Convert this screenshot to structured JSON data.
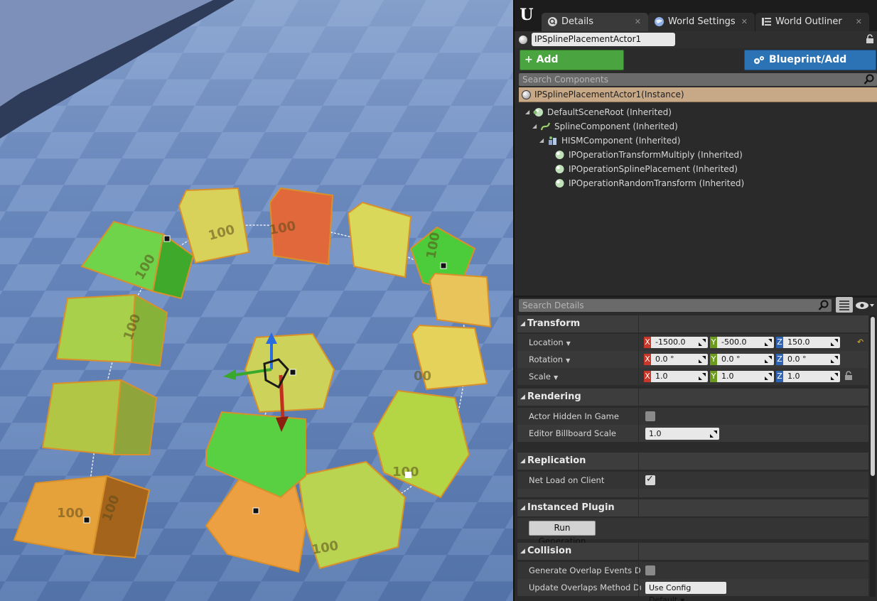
{
  "tabs": [
    {
      "label": "Details",
      "icon": "details-magnifier-icon"
    },
    {
      "label": "World Settings",
      "icon": "globe-icon"
    },
    {
      "label": "World Outliner",
      "icon": "outliner-list-icon"
    }
  ],
  "actor": {
    "name": "IPSplinePlacementActor1"
  },
  "toolbar": {
    "add_component": "+ Add Component",
    "blueprint": "Blueprint/Add Script"
  },
  "search_components": {
    "placeholder": "Search Components"
  },
  "instance_label": "IPSplinePlacementActor1(Instance)",
  "components": [
    {
      "label": "DefaultSceneRoot (Inherited)",
      "icon": "scene-root-icon"
    },
    {
      "label": "SplineComponent (Inherited)",
      "icon": "spline-icon"
    },
    {
      "label": "HISMComponent (Inherited)",
      "icon": "hism-icon"
    },
    {
      "label": "IPOperationTransformMultiply (Inherited)",
      "icon": "operation-sphere-icon"
    },
    {
      "label": "IPOperationSplinePlacement (Inherited)",
      "icon": "operation-sphere-icon"
    },
    {
      "label": "IPOperationRandomTransform (Inherited)",
      "icon": "operation-sphere-icon"
    }
  ],
  "search_details": {
    "placeholder": "Search Details"
  },
  "transform": {
    "title": "Transform",
    "location": {
      "label": "Location",
      "x": "-1500.0",
      "y": "-500.0",
      "z": "150.0"
    },
    "rotation": {
      "label": "Rotation",
      "x": "0.0 °",
      "y": "0.0 °",
      "z": "0.0 °"
    },
    "scale": {
      "label": "Scale",
      "x": "1.0",
      "y": "1.0",
      "z": "1.0"
    }
  },
  "axis_labels": {
    "x": "X",
    "y": "Y",
    "z": "Z"
  },
  "rendering": {
    "title": "Rendering",
    "actor_hidden_label": "Actor Hidden In Game",
    "actor_hidden_checked": false,
    "billboard_label": "Editor Billboard Scale",
    "billboard_value": "1.0"
  },
  "replication": {
    "title": "Replication",
    "net_load_label": "Net Load on Client",
    "net_load_checked": true
  },
  "instanced_plugin": {
    "title": "Instanced Plugin",
    "run_label": "Run Generation"
  },
  "collision": {
    "title": "Collision",
    "overlap_events_label": "Generate Overlap Events During",
    "overlap_events_checked": false,
    "update_method_label": "Update Overlaps Method During",
    "update_method_value": "Use Config Default"
  },
  "viewport": {
    "cube_label": "100",
    "scene": "viewport-spline-cubes"
  },
  "colors": {
    "add_component_green": "#4aa43f",
    "blueprint_blue": "#2b73b5",
    "selected_row": "#c8a987",
    "axis_x": "#c9362a",
    "axis_y": "#6c9a1a",
    "axis_z": "#2f63b3"
  }
}
